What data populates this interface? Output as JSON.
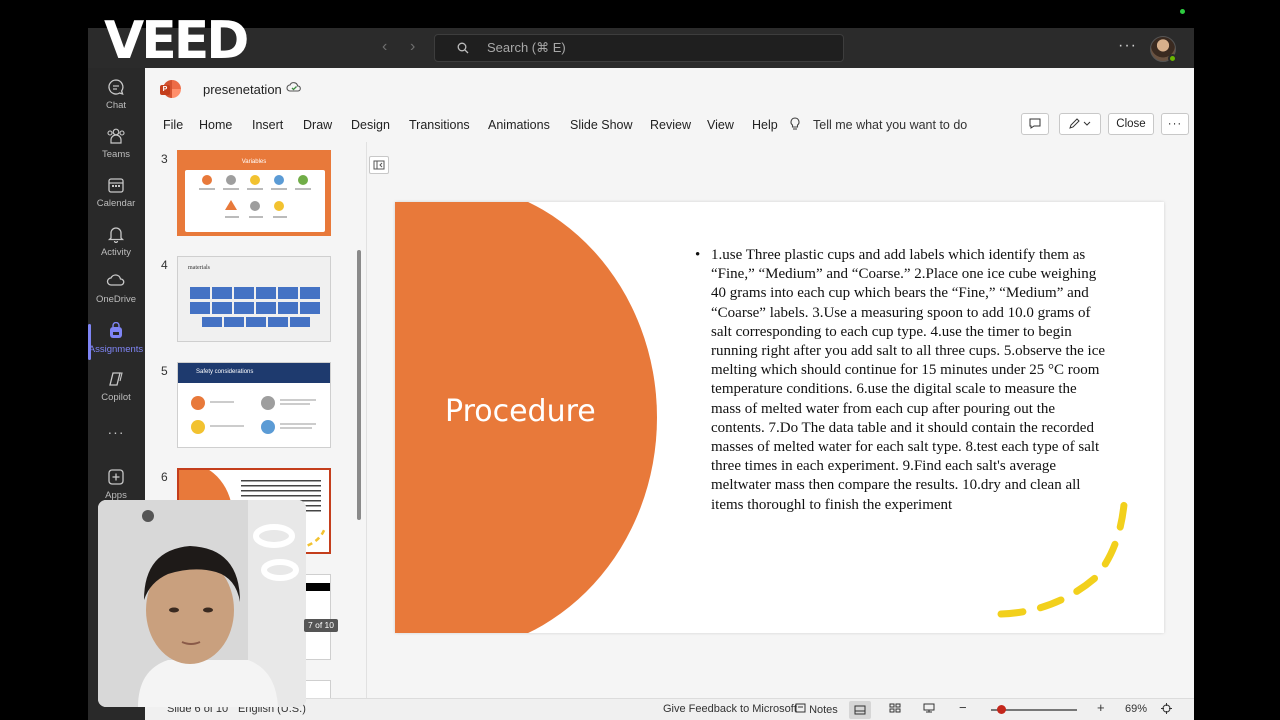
{
  "titlebar": {
    "search_placeholder": "Search (⌘ E)",
    "search_icon": "search-icon",
    "more_label": "···",
    "nav_back_icon": "chevron-left-icon",
    "nav_forward_icon": "chevron-right-icon"
  },
  "overlay": {
    "logo_text": "VEED",
    "slide_counter": "7 of 10"
  },
  "rail": {
    "items": [
      {
        "label": "Chat",
        "icon": "chat-icon"
      },
      {
        "label": "Teams",
        "icon": "teams-icon"
      },
      {
        "label": "Calendar",
        "icon": "calendar-icon"
      },
      {
        "label": "Activity",
        "icon": "bell-icon"
      },
      {
        "label": "OneDrive",
        "icon": "cloud-icon"
      },
      {
        "label": "Assignments",
        "icon": "backpack-icon",
        "active": true
      },
      {
        "label": "Copilot",
        "icon": "copilot-icon"
      },
      {
        "label": "···",
        "icon": "more-icon"
      },
      {
        "label": "Apps",
        "icon": "apps-plus-icon"
      }
    ]
  },
  "file": {
    "name": "presenetation"
  },
  "menu": {
    "items": [
      "File",
      "Home",
      "Insert",
      "Draw",
      "Design",
      "Transitions",
      "Animations",
      "Slide Show",
      "Review",
      "View",
      "Help"
    ],
    "tell_me": "Tell me what you want to do",
    "close_label": "Close",
    "more_label": "···"
  },
  "thumbnails": [
    {
      "number": "3",
      "title": "Variables"
    },
    {
      "number": "4",
      "title": "materials"
    },
    {
      "number": "5",
      "title": "Safety considerations"
    },
    {
      "number": "6",
      "title": ""
    }
  ],
  "slide": {
    "title": "Procedure",
    "body": "1.use Three plastic cups and add labels which identify them as “Fine,” “Medium” and “Coarse.” 2.Place one ice cube weighing 40 grams into each cup which bears the “Fine,” “Medium” and “Coarse” labels. 3.Use a measuring spoon to add 10.0 grams of salt corresponding to each cup type. 4.use the timer to begin running right after you add salt to all three cups. 5.observe the ice melting which should continue for 15 minutes under 25 °C room temperature conditions. 6.use the digital scale to measure the mass of melted water from each cup after pouring out the contents. 7.Do The data table and it should contain the recorded masses of melted water for each salt type. 8.test each type of salt three times in each experiment. 9.Find each salt's average meltwater mass then compare the results. 10.dry and clean all items thoroughl to finish the experiment",
    "accent_color": "#e8793a"
  },
  "status": {
    "slide_info": "Slide 6 of 10",
    "language": "English (U.S.)",
    "feedback": "Give Feedback to Microsoft",
    "notes": "Notes",
    "zoom": "69%"
  }
}
